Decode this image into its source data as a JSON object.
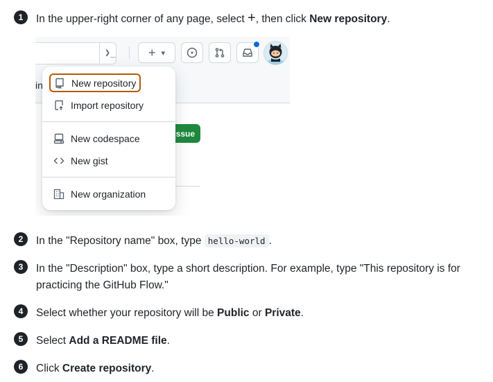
{
  "steps": [
    {
      "num": "1",
      "pre": "In the upper-right corner of any page, select ",
      "symbol": "+",
      "mid": ", then click ",
      "bold": "New repository",
      "post": "."
    },
    {
      "num": "2",
      "pre": "In the \"Repository name\" box, type ",
      "code": "hello-world",
      "post": "."
    },
    {
      "num": "3",
      "text": "In the \"Description\" box, type a short description. For example, type \"This repository is for practicing the GitHub Flow.\""
    },
    {
      "num": "4",
      "pre": "Select whether your repository will be ",
      "bold1": "Public",
      "mid": " or ",
      "bold2": "Private",
      "post": "."
    },
    {
      "num": "5",
      "pre": "Select ",
      "bold": "Add a README file",
      "post": "."
    },
    {
      "num": "6",
      "pre": "Click ",
      "bold": "Create repository",
      "post": "."
    }
  ],
  "screenshot": {
    "terminal_glyph": "❯_",
    "plus": "+",
    "caret": "▾",
    "fragment_in": "in",
    "issue_fragment": "ssue",
    "accent_color": "#b35900",
    "green": "#1f883d",
    "menu": [
      {
        "label": "New repository",
        "icon": "repo-icon",
        "highlighted": true
      },
      {
        "label": "Import repository",
        "icon": "repo-push-icon"
      },
      {
        "label": "New codespace",
        "icon": "codespaces-icon"
      },
      {
        "label": "New gist",
        "icon": "code-icon"
      },
      {
        "label": "New organization",
        "icon": "organization-icon"
      }
    ]
  }
}
